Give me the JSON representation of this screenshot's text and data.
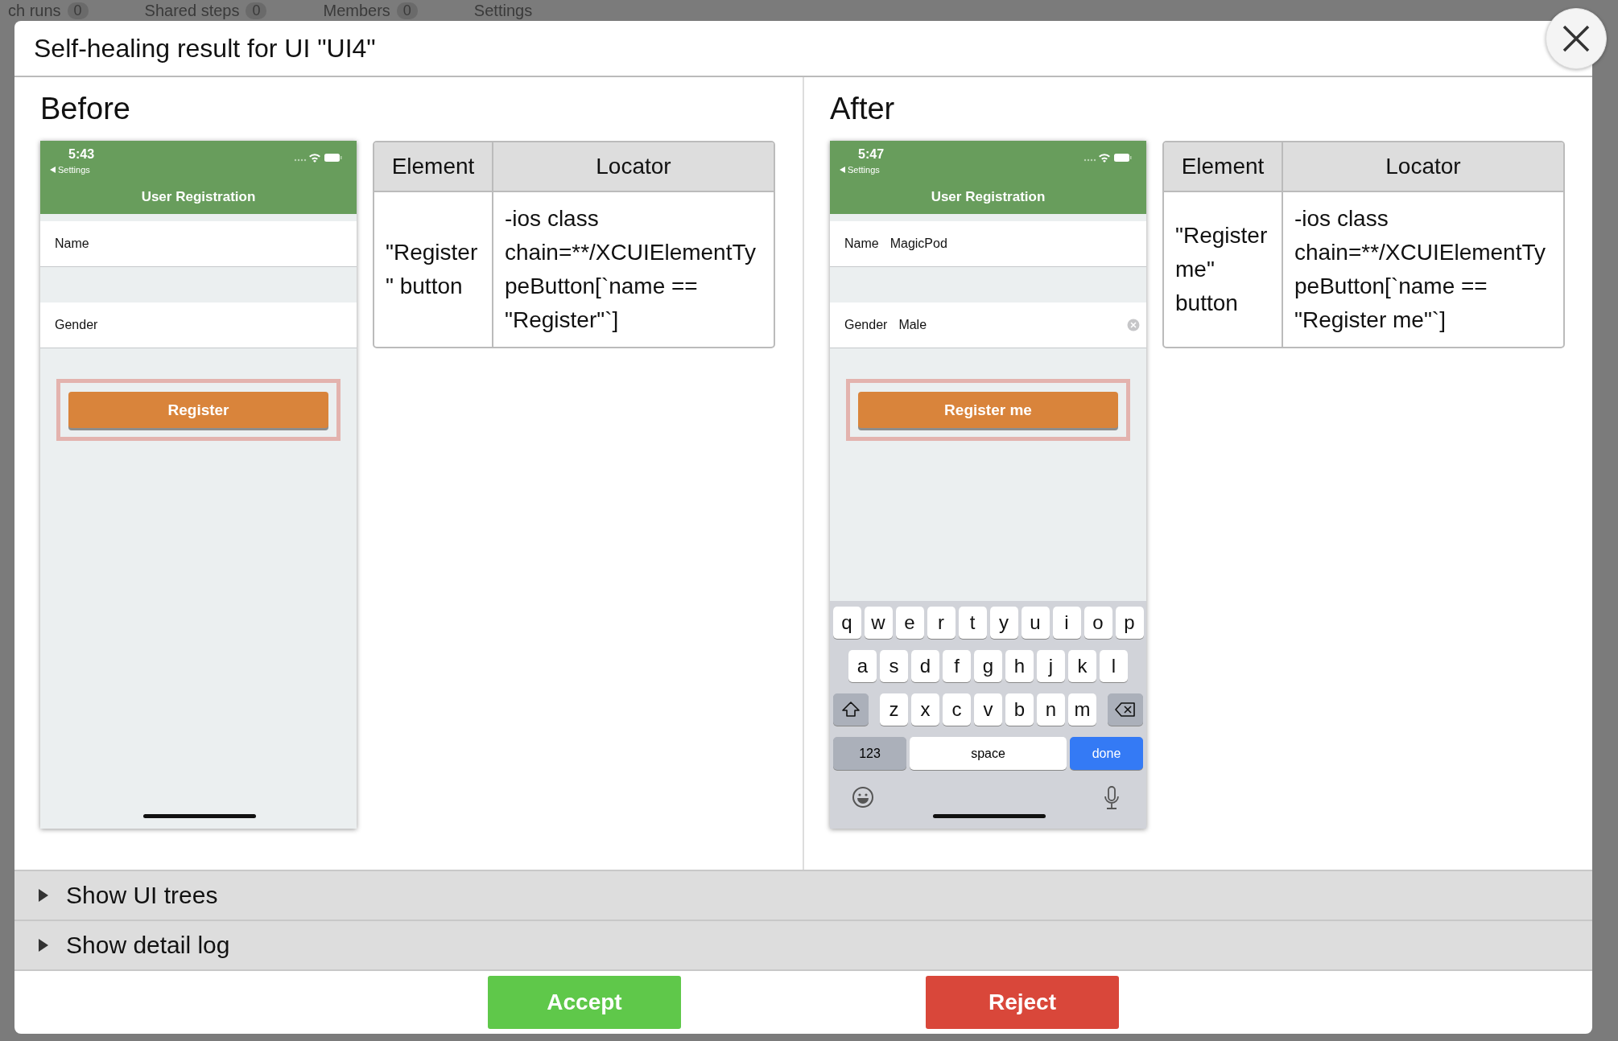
{
  "background_tabs": [
    {
      "label": "ch runs",
      "count": "0"
    },
    {
      "label": "Shared steps",
      "count": "0"
    },
    {
      "label": "Members",
      "count": "0"
    },
    {
      "label": "Settings"
    }
  ],
  "dialog": {
    "title": "Self-healing result for UI \"UI4\""
  },
  "panels": [
    {
      "heading": "Before",
      "phone": {
        "time": "5:43",
        "back": "Settings",
        "title": "User Registration",
        "fields": [
          {
            "label": "Name",
            "clearable": false
          },
          {
            "label": "Gender",
            "clearable": false
          }
        ],
        "button": "Register"
      },
      "table": {
        "columns": [
          "Element",
          "Locator"
        ],
        "element": "\"Register\" button",
        "locator": "-ios class chain=**/XCUIElementTypeButton[`name == \"Register\"`]"
      }
    },
    {
      "heading": "After",
      "phone": {
        "time": "5:47",
        "back": "Settings",
        "title": "User Registration",
        "fields": [
          {
            "label": "Name",
            "value": "MagicPod",
            "clearable": false
          },
          {
            "label": "Gender",
            "value": "Male",
            "clearable": true
          }
        ],
        "button": "Register me",
        "keyboard": {
          "rows": [
            [
              "q",
              "w",
              "e",
              "r",
              "t",
              "y",
              "u",
              "i",
              "o",
              "p"
            ],
            [
              "a",
              "s",
              "d",
              "f",
              "g",
              "h",
              "j",
              "k",
              "l"
            ],
            [
              "z",
              "x",
              "c",
              "v",
              "b",
              "n",
              "m"
            ]
          ],
          "numbers": "123",
          "space": "space",
          "done": "done"
        }
      },
      "table": {
        "columns": [
          "Element",
          "Locator"
        ],
        "element": "\"Register me\" button",
        "locator": "-ios class chain=**/XCUIElementTypeButton[`name == \"Register me\"`]"
      }
    }
  ],
  "sections": [
    {
      "label": "Show UI trees",
      "expanded": false
    },
    {
      "label": "Show detail log",
      "expanded": false
    }
  ],
  "buttons": [
    {
      "label": "Accept",
      "kind": "accept"
    },
    {
      "label": "Reject",
      "kind": "reject"
    }
  ]
}
